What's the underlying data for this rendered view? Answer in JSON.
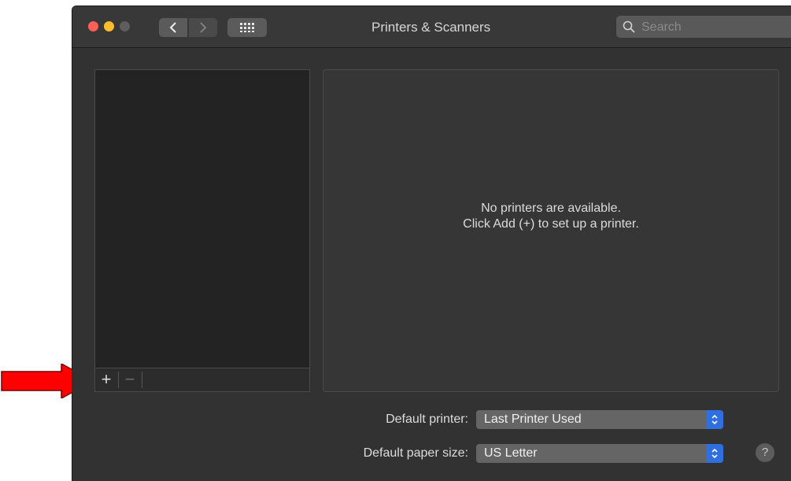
{
  "window": {
    "title": "Printers & Scanners"
  },
  "search": {
    "placeholder": "Search"
  },
  "printer_list": {
    "add_label": "+",
    "remove_label": "−"
  },
  "detail": {
    "empty_line1": "No printers are available.",
    "empty_line2": "Click Add (+) to set up a printer."
  },
  "settings": {
    "default_printer_label": "Default printer:",
    "default_printer_value": "Last Printer Used",
    "paper_size_label": "Default paper size:",
    "paper_size_value": "US Letter"
  },
  "help": {
    "label": "?"
  },
  "colors": {
    "annotation_arrow": "#ff0000",
    "close_light": "#fe5f57",
    "minimize_light": "#febc2e",
    "stepper_accent": "#2f6fe0"
  },
  "icons": {
    "back": "chevron-left-icon",
    "forward": "chevron-right-icon",
    "grid": "grid-icon",
    "search": "search-icon",
    "stepper": "up-down-chevron-icon"
  }
}
